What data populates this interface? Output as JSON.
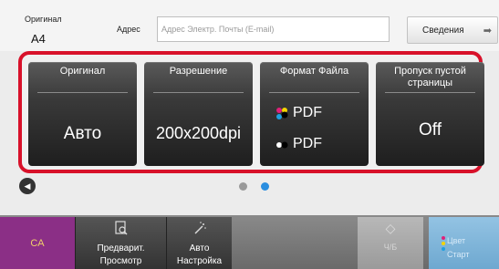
{
  "header": {
    "original_label": "Оригинал",
    "original_value": "A4",
    "address_label": "Адрес",
    "address_placeholder": "Адрес Электр. Почты (E-mail)",
    "details_button": "Сведения"
  },
  "tiles": [
    {
      "title": "Оригинал",
      "value": "Авто"
    },
    {
      "title": "Разрешение",
      "value": "200x200dpi"
    },
    {
      "title": "Формат Файла",
      "value_line1": "PDF",
      "value_line2": "PDF"
    },
    {
      "title": "Пропуск пустой страницы",
      "value": "Off"
    }
  ],
  "pager": {
    "pages": 2,
    "active_page": 2
  },
  "bottom": {
    "ca_label": "CA",
    "preview_line1": "Предварит.",
    "preview_line2": "Просмотр",
    "auto_line1": "Авто",
    "auto_line2": "Настройка",
    "bw_start_label": "Ч/Б",
    "color_label": "Цвет",
    "start_label": "Старт"
  },
  "colors": {
    "highlight_frame": "#d8112a",
    "ca_button": "#8b2f86",
    "color_start_button": "#6ea8d0"
  },
  "icons": [
    "chevron-left-icon",
    "arrow-right-icon",
    "preview-icon",
    "auto-wand-icon",
    "diamond-start-icon",
    "color-dots-icon"
  ]
}
